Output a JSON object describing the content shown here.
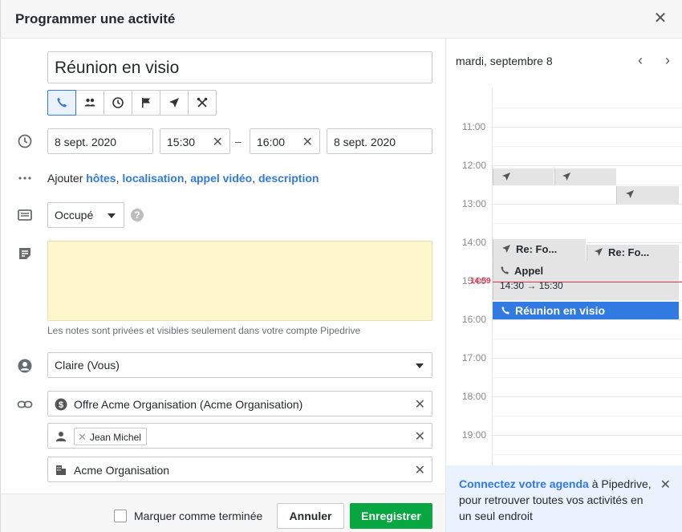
{
  "dialog": {
    "title": "Programmer une activité",
    "close_icon": "close-icon"
  },
  "subject": {
    "value": "Réunion en visio"
  },
  "activity_types": [
    {
      "name": "call",
      "icon": "phone-icon",
      "active": true
    },
    {
      "name": "meeting",
      "icon": "people-icon",
      "active": false
    },
    {
      "name": "task",
      "icon": "clock-icon",
      "active": false
    },
    {
      "name": "deadline",
      "icon": "flag-icon",
      "active": false
    },
    {
      "name": "email",
      "icon": "send-icon",
      "active": false
    },
    {
      "name": "lunch",
      "icon": "cutlery-icon",
      "active": false
    }
  ],
  "datetime": {
    "start_date": "8 sept. 2020",
    "start_time": "15:30",
    "separator": "–",
    "end_time": "16:00",
    "end_date": "8 sept. 2020"
  },
  "add_row": {
    "prefix": "Ajouter",
    "links": [
      "hôtes",
      "localisation",
      "appel vidéo",
      "description"
    ],
    "separator": ","
  },
  "busy": {
    "value": "Occupé",
    "help": "?"
  },
  "notes": {
    "hint": "Les notes sont privées et visibles seulement dans votre compte Pipedrive"
  },
  "owner": {
    "value": "Claire (Vous)"
  },
  "links": {
    "deal": "Offre Acme Organisation (Acme Organisation)",
    "person_chip": "Jean Michel",
    "organization": "Acme Organisation"
  },
  "footer": {
    "done_label": "Marquer comme terminée",
    "cancel": "Annuler",
    "save": "Enregistrer"
  },
  "calendar": {
    "date_label": "mardi, septembre 8",
    "hours": [
      "11:00",
      "12:00",
      "13:00",
      "14:00",
      "15:00",
      "16:00",
      "17:00",
      "18:00",
      "19:00"
    ],
    "now_label": "14:59",
    "events": {
      "re_fo_1": "Re: Fo...",
      "re_fo_2": "Re: Fo...",
      "appel_title": "Appel",
      "appel_time": "14:30 → 15:30",
      "current": "Réunion en visio"
    }
  },
  "promo": {
    "link": "Connectez votre agenda",
    "text": " à Pipedrive, pour retrouver toutes vos activités en un seul endroit"
  },
  "colors": {
    "accent": "#317ae2",
    "save": "#08a742",
    "notes_bg": "#fff7cc",
    "now": "#e2314a"
  }
}
